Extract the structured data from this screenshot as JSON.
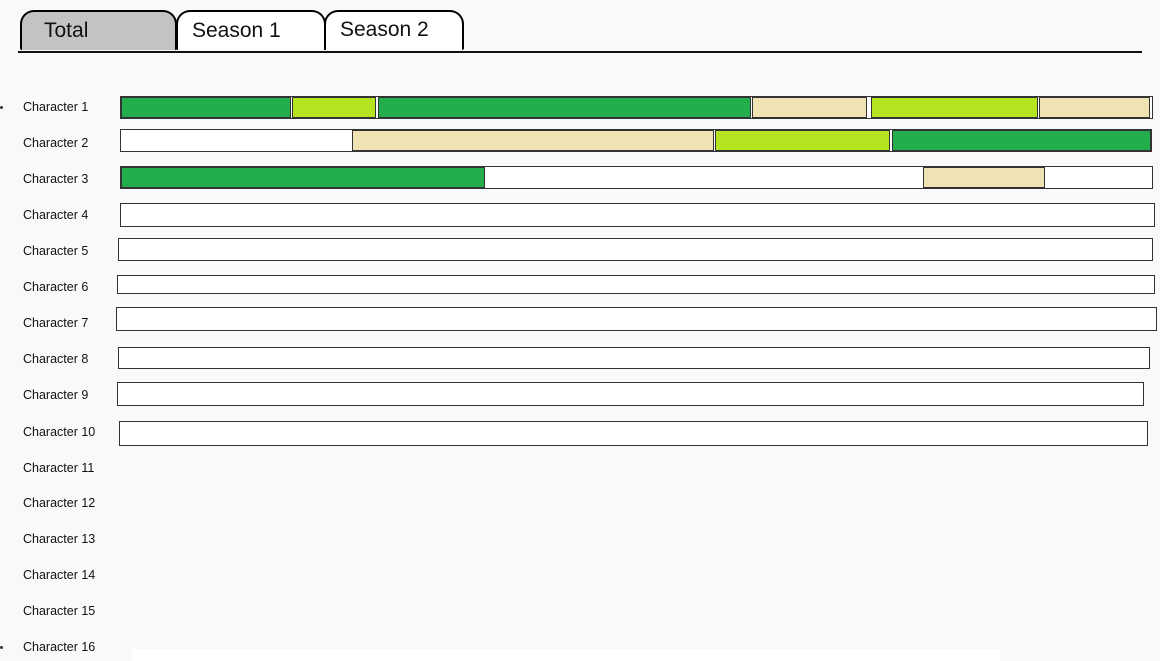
{
  "tabs": [
    {
      "label": "Total",
      "active": true
    },
    {
      "label": "Season 1",
      "active": false
    },
    {
      "label": "Season 2",
      "active": false
    }
  ],
  "colors": {
    "dark_green": "#24ad4d",
    "lime": "#b4e520",
    "cream": "#efe3b3"
  },
  "characters": [
    {
      "label": "Character 1",
      "segments": [
        {
          "start": 0.0,
          "end": 0.165,
          "color": "dark_green"
        },
        {
          "start": 0.166,
          "end": 0.247,
          "color": "lime"
        },
        {
          "start": 0.249,
          "end": 0.611,
          "color": "dark_green"
        },
        {
          "start": 0.612,
          "end": 0.724,
          "color": "cream"
        },
        {
          "start": 0.727,
          "end": 0.889,
          "color": "lime"
        },
        {
          "start": 0.89,
          "end": 0.998,
          "color": "cream"
        }
      ]
    },
    {
      "label": "Character 2",
      "segments": [
        {
          "start": 0.224,
          "end": 0.576,
          "color": "cream"
        },
        {
          "start": 0.577,
          "end": 0.747,
          "color": "lime"
        },
        {
          "start": 0.749,
          "end": 1.0,
          "color": "dark_green"
        }
      ]
    },
    {
      "label": "Character 3",
      "segments": [
        {
          "start": 0.0,
          "end": 0.353,
          "color": "dark_green"
        },
        {
          "start": 0.778,
          "end": 0.896,
          "color": "cream"
        }
      ]
    },
    {
      "label": "Character 4",
      "segments": []
    },
    {
      "label": "Character 5",
      "segments": []
    },
    {
      "label": "Character 6",
      "segments": []
    },
    {
      "label": "Character 7",
      "segments": []
    },
    {
      "label": "Character 8",
      "segments": []
    },
    {
      "label": "Character 9",
      "segments": []
    },
    {
      "label": "Character 10",
      "segments": []
    },
    {
      "label": "Character 11"
    },
    {
      "label": "Character 12"
    },
    {
      "label": "Character 13"
    },
    {
      "label": "Character 14"
    },
    {
      "label": "Character 15"
    },
    {
      "label": "Character 16"
    }
  ]
}
